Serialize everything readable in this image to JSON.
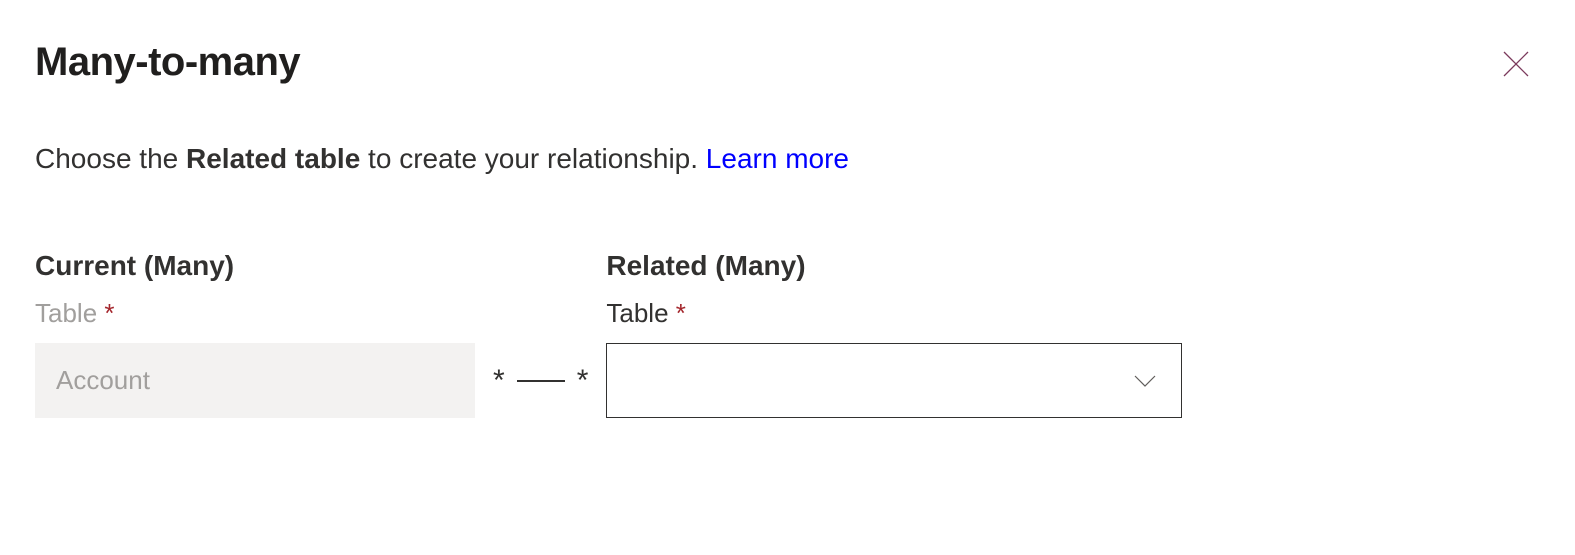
{
  "header": {
    "title": "Many-to-many"
  },
  "description": {
    "prefix": "Choose the ",
    "bold": "Related table",
    "suffix": " to create your relationship. ",
    "link_text": "Learn more"
  },
  "current": {
    "heading": "Current (Many)",
    "field_label": "Table",
    "required_marker": "*",
    "value": "Account"
  },
  "connector": {
    "left_star": "*",
    "right_star": "*"
  },
  "related": {
    "heading": "Related (Many)",
    "field_label": "Table",
    "required_marker": "*",
    "value": ""
  }
}
